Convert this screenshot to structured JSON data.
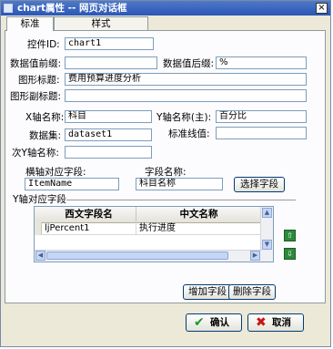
{
  "window": {
    "title": "chart属性 -- 网页对话框",
    "close_glyph": "×"
  },
  "tabs": [
    {
      "label": "标准",
      "active": true
    },
    {
      "label": "样式",
      "active": false
    }
  ],
  "form": {
    "control_id": {
      "label": "控件ID:",
      "value": "chart1"
    },
    "value_prefix": {
      "label": "数据值前缀:",
      "value": ""
    },
    "value_suffix": {
      "label": "数据值后缀:",
      "value": "%"
    },
    "chart_title": {
      "label": "图形标题:",
      "value": "费用预算进度分析"
    },
    "chart_subtitle": {
      "label": "图形副标题:",
      "value": ""
    },
    "x_axis_name": {
      "label": "X轴名称:",
      "value": "科目"
    },
    "y_axis_name": {
      "label": "Y轴名称(主):",
      "value": "百分比"
    },
    "dataset": {
      "label": "数据集:",
      "value": "dataset1"
    },
    "std_line": {
      "label": "标准线值:",
      "value": ""
    },
    "sub_y_axis_name": {
      "label": "次Y轴名称:",
      "value": ""
    },
    "x_field": {
      "label": "横轴对应字段:",
      "value": "ItemName"
    },
    "field_name": {
      "label": "字段名称:",
      "value": "科目名称"
    },
    "select_field_button": "选择字段",
    "y_field_section": "Y轴对应字段"
  },
  "grid": {
    "columns": [
      "西文字段名",
      "中文名称"
    ],
    "rows": [
      {
        "field": "ljPercent1",
        "name": "执行进度"
      }
    ],
    "scroll_up": "▲",
    "scroll_down": "▼",
    "scroll_left": "◀",
    "scroll_right": "▶"
  },
  "move_up_glyph": "⇧",
  "move_down_glyph": "⇩",
  "add_field_button": "增加字段",
  "delete_field_button": "删除字段",
  "footer": {
    "ok_icon": "✔",
    "ok_label": "确认",
    "cancel_icon": "✖",
    "cancel_label": "取消"
  },
  "colors": {
    "titlebar": "#2a56b6",
    "ok_icon": "#1c9a2a",
    "cancel_icon": "#cc1111",
    "move_button": "#2c8a3a"
  }
}
